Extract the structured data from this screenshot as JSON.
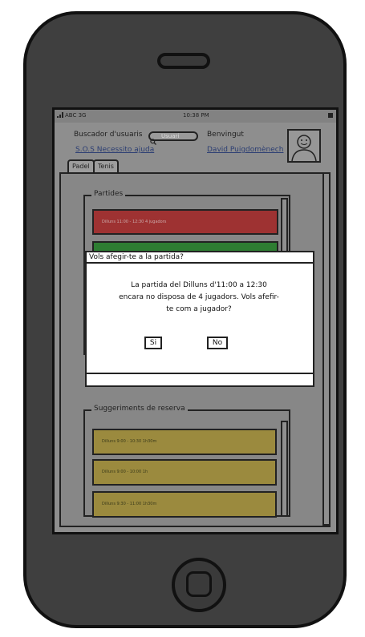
{
  "status_bar": {
    "carrier": "ABC 3G",
    "time": "10:38 PM"
  },
  "header": {
    "search_label": "Buscador d'usuaris",
    "search_placeholder": "Usuari",
    "welcome": "Benvingut",
    "sos_link": "S.O.S Necessito ajuda",
    "user_name": "David Puigdomènech"
  },
  "tabs": [
    {
      "label": "Padel",
      "selected": true
    },
    {
      "label": "Tenis",
      "selected": false
    }
  ],
  "partides": {
    "title": "Partides",
    "items": [
      {
        "text": "Dilluns 11:00 - 12:30 4 jugadors",
        "color": "#9e3232"
      },
      {
        "text": "",
        "color": "#2e7d32"
      }
    ]
  },
  "dialog": {
    "title": "Vols afegir-te a la partida?",
    "message": "La partida del Dilluns d'11:00 a 12:30 encara no disposa de 4 jugadors. Vols afefir-te com a jugador?",
    "yes_label": "Si",
    "no_label": "No"
  },
  "suggeriments": {
    "title": "Suggeriments de reserva",
    "items": [
      {
        "text": "Dilluns 9:00 - 10:30 1h30m",
        "color": "#9b8a3e"
      },
      {
        "text": "Dilluns 9:00 - 10:00 1h",
        "color": "#9b8a3e"
      },
      {
        "text": "Dilluns 9:30 - 11:00 1h30m",
        "color": "#9b8a3e"
      }
    ]
  },
  "colors": {
    "phone_body": "#3f3f3f",
    "screen": "#8e8e8e",
    "link": "#2c3e73",
    "dialog_bg": "#ffffff"
  }
}
